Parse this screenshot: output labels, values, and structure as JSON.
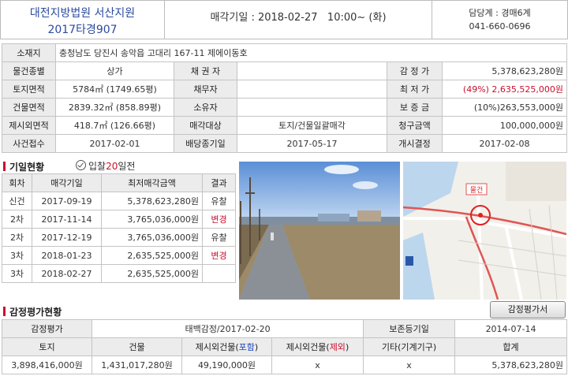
{
  "header": {
    "court": "대전지방법원 서산지원",
    "case_no": "2017타경907",
    "sale_date_label": "매각기일 : 2018-02-27",
    "sale_time": "10:00~ (화)",
    "dept": "담당계 : 경매6계",
    "phone": "041-660-0696"
  },
  "info": {
    "address_label": "소재지",
    "address": "충청남도 당진시 송악읍 고대리 167-11 제에이동호",
    "rows": [
      {
        "l1": "물건종별",
        "v1": "상가",
        "l2": "채 권 자",
        "v2": "",
        "l3": "감 정 가",
        "v3": "5,378,623,280원"
      },
      {
        "l1": "토지면적",
        "v1": "5784㎡ (1749.65평)",
        "l2": "채무자",
        "v2": "",
        "l3": "최 저 가",
        "v3": "(49%) 2,635,525,000원"
      },
      {
        "l1": "건물면적",
        "v1": "2839.32㎡ (858.89평)",
        "l2": "소유자",
        "v2": "",
        "l3": "보 증 금",
        "v3": "(10%)263,553,000원"
      },
      {
        "l1": "제시외면적",
        "v1": "418.7㎡ (126.66평)",
        "l2": "매각대상",
        "v2": "토지/건물일괄매각",
        "l3": "청구금액",
        "v3": "100,000,000원"
      },
      {
        "l1": "사건접수",
        "v1": "2017-02-01",
        "l2": "배당종기일",
        "v2": "2017-05-17",
        "l3": "개시결정",
        "v3": "2017-02-08"
      }
    ]
  },
  "history": {
    "title": "기일현황",
    "bid_prefix": "입찰",
    "bid_days": "20",
    "bid_suffix": "일전",
    "headers": [
      "회차",
      "매각기일",
      "최저매각금액",
      "결과"
    ],
    "rows": [
      {
        "round": "신건",
        "date": "2017-09-19",
        "price": "5,378,623,280원",
        "result": "유찰"
      },
      {
        "round": "2차",
        "date": "2017-11-14",
        "price": "3,765,036,000원",
        "result": "변경"
      },
      {
        "round": "2차",
        "date": "2017-12-19",
        "price": "3,765,036,000원",
        "result": "유찰"
      },
      {
        "round": "3차",
        "date": "2018-01-23",
        "price": "2,635,525,000원",
        "result": "변경"
      },
      {
        "round": "3차",
        "date": "2018-02-27",
        "price": "2,635,525,000원",
        "result": ""
      }
    ]
  },
  "map": {
    "marker_label": "물건"
  },
  "appraisal": {
    "title": "감정평가현황",
    "button": "감정평가서",
    "label": "감정평가",
    "agency": "태백감정/2017-02-20",
    "preserve_label": "보존등기일",
    "preserve_date": "2014-07-14",
    "cols": {
      "land": "토지",
      "building": "건물",
      "extra_incl_prefix": "제시외건물(",
      "extra_incl_mid": "포함",
      "extra_incl_suffix": ")",
      "extra_excl_prefix": "제시외건물(",
      "extra_excl_mid": "제외",
      "extra_excl_suffix": ")",
      "other": "기타(기계기구)",
      "total": "합계"
    },
    "values": {
      "land": "3,898,416,000원",
      "building": "1,431,017,280원",
      "extra_incl": "49,190,000원",
      "extra_excl": "x",
      "other": "x",
      "total": "5,378,623,280원"
    }
  },
  "colors": {
    "accent_red": "#c8102e",
    "title_blue": "#2b4aa0"
  }
}
